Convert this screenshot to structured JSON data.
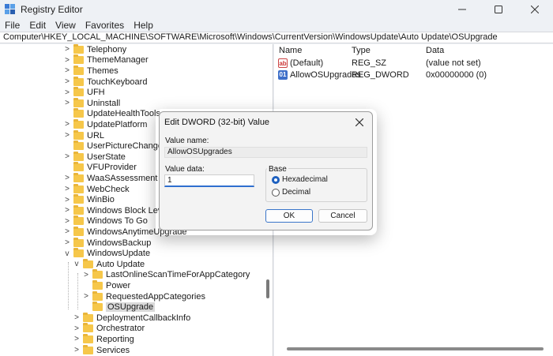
{
  "window": {
    "title": "Registry Editor"
  },
  "menu": [
    "File",
    "Edit",
    "View",
    "Favorites",
    "Help"
  ],
  "address": "Computer\\HKEY_LOCAL_MACHINE\\SOFTWARE\\Microsoft\\Windows\\CurrentVersion\\WindowsUpdate\\Auto Update\\OSUpgrade",
  "tree": [
    {
      "label": "Telephony",
      "level": 0,
      "expander": ">"
    },
    {
      "label": "ThemeManager",
      "level": 0,
      "expander": ">"
    },
    {
      "label": "Themes",
      "level": 0,
      "expander": ">"
    },
    {
      "label": "TouchKeyboard",
      "level": 0,
      "expander": ">"
    },
    {
      "label": "UFH",
      "level": 0,
      "expander": ">"
    },
    {
      "label": "Uninstall",
      "level": 0,
      "expander": ">"
    },
    {
      "label": "UpdateHealthTools",
      "level": 0,
      "expander": ""
    },
    {
      "label": "UpdatePlatform",
      "level": 0,
      "expander": ">"
    },
    {
      "label": "URL",
      "level": 0,
      "expander": ">"
    },
    {
      "label": "UserPictureChange",
      "level": 0,
      "expander": ""
    },
    {
      "label": "UserState",
      "level": 0,
      "expander": ">"
    },
    {
      "label": "VFUProvider",
      "level": 0,
      "expander": ""
    },
    {
      "label": "WaaSAssessment",
      "level": 0,
      "expander": ">"
    },
    {
      "label": "WebCheck",
      "level": 0,
      "expander": ">"
    },
    {
      "label": "WinBio",
      "level": 0,
      "expander": ">"
    },
    {
      "label": "Windows Block Level Ba",
      "level": 0,
      "expander": ">"
    },
    {
      "label": "Windows To Go",
      "level": 0,
      "expander": ">"
    },
    {
      "label": "WindowsAnytimeUpgrade",
      "level": 0,
      "expander": ">"
    },
    {
      "label": "WindowsBackup",
      "level": 0,
      "expander": ">"
    },
    {
      "label": "WindowsUpdate",
      "level": 0,
      "expander": "v"
    },
    {
      "label": "Auto Update",
      "level": 1,
      "expander": "v"
    },
    {
      "label": "LastOnlineScanTimeForAppCategory",
      "level": 2,
      "expander": ">"
    },
    {
      "label": "Power",
      "level": 2,
      "expander": ""
    },
    {
      "label": "RequestedAppCategories",
      "level": 2,
      "expander": ">"
    },
    {
      "label": "OSUpgrade",
      "level": 2,
      "expander": "",
      "selected": true
    },
    {
      "label": "DeploymentCallbackInfo",
      "level": 1,
      "expander": ">"
    },
    {
      "label": "Orchestrator",
      "level": 1,
      "expander": ">"
    },
    {
      "label": "Reporting",
      "level": 1,
      "expander": ">"
    },
    {
      "label": "Services",
      "level": 1,
      "expander": ">"
    }
  ],
  "list": {
    "headers": {
      "name": "Name",
      "type": "Type",
      "data": "Data"
    },
    "rows": [
      {
        "icon": "string-value-icon",
        "icon_text": "ab",
        "name": "(Default)",
        "type": "REG_SZ",
        "data": "(value not set)"
      },
      {
        "icon": "dword-value-icon",
        "icon_text": "01",
        "name": "AllowOSUpgrades",
        "type": "REG_DWORD",
        "data": "0x00000000 (0)"
      }
    ]
  },
  "dialog": {
    "title": "Edit DWORD (32-bit) Value",
    "value_name_label": "Value name:",
    "value_name": "AllowOSUpgrades",
    "value_data_label": "Value data:",
    "value_data": "1",
    "base_label": "Base",
    "base_options": [
      "Hexadecimal",
      "Decimal"
    ],
    "base_selected": "Hexadecimal",
    "ok_label": "OK",
    "cancel_label": "Cancel"
  }
}
